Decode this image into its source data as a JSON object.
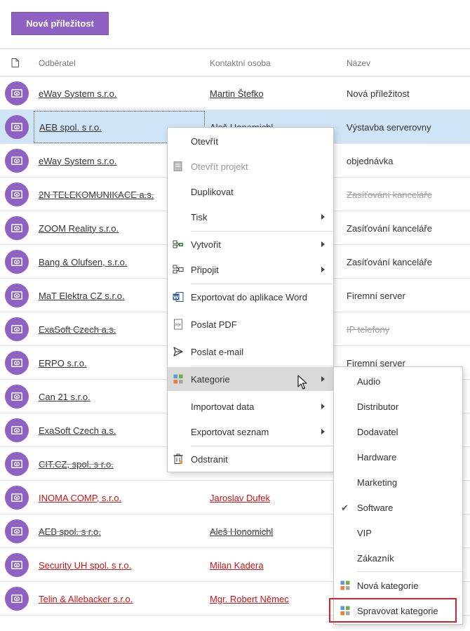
{
  "toolbar": {
    "new_button_label": "Nová příležitost"
  },
  "grid": {
    "columns": [
      "Odběratel",
      "Kontaktní osoba",
      "Název"
    ],
    "rows": [
      {
        "customer": "eWay System s.r.o.",
        "contact": "Martin Štefko",
        "name": "Nová příležitost",
        "state": "normal"
      },
      {
        "customer": "AEB spol. s r.o.",
        "contact": "Aleš Honomichl",
        "name": "Výstavba serverovny",
        "state": "selected"
      },
      {
        "customer": "eWay System s.r.o.",
        "contact": "",
        "name": "objednávka",
        "state": "normal"
      },
      {
        "customer": "2N TELEKOMUNIKACE a.s.",
        "contact": "",
        "name": "Zasíťování kanceláře",
        "state": "strike"
      },
      {
        "customer": "ZOOM Reality s.r.o.",
        "contact": "",
        "name": "Zasíťování kanceláře",
        "state": "normal"
      },
      {
        "customer": "Bang & Olufsen, s.r.o.",
        "contact": "",
        "name": "Zasíťování kanceláře",
        "state": "normal"
      },
      {
        "customer": "MaT Elektra CZ s.r.o.",
        "contact": "",
        "name": "Firemní server",
        "state": "normal"
      },
      {
        "customer": "ExaSoft Czech a.s.",
        "contact": "",
        "name": "IP telefony",
        "state": "strike"
      },
      {
        "customer": "ERPO s.r.o.",
        "contact": "",
        "name": "Firemní server",
        "state": "normal"
      },
      {
        "customer": "Can 21 s.r.o.",
        "contact": "",
        "name": "",
        "state": "normal"
      },
      {
        "customer": "ExaSoft Czech a.s.",
        "contact": "",
        "name": "",
        "state": "normal"
      },
      {
        "customer": "CIT.CZ, spol. s r.o.",
        "contact": "",
        "name": "",
        "state": "strike"
      },
      {
        "customer": "INOMA COMP, s.r.o.",
        "contact": "Jaroslav Dufek",
        "name": "",
        "state": "red"
      },
      {
        "customer": "AEB spol. s r.o.",
        "contact": "Aleš Honomichl",
        "name": "",
        "state": "strike"
      },
      {
        "customer": "Security UH spol. s r.o.",
        "contact": "Milan Kadera",
        "name": "",
        "state": "red"
      },
      {
        "customer": "Telin & Allebacker s.r.o.",
        "contact": "Mgr. Robert Němec",
        "name": "",
        "state": "red"
      }
    ]
  },
  "context_menu": {
    "items": [
      {
        "label": "Otevřít",
        "icon": "",
        "submenu": false,
        "disabled": false
      },
      {
        "label": "Otevřít projekt",
        "icon": "project-icon",
        "submenu": false,
        "disabled": true
      },
      {
        "label": "Duplikovat",
        "icon": "",
        "submenu": false,
        "disabled": false
      },
      {
        "label": "Tisk",
        "icon": "",
        "submenu": true,
        "disabled": false
      },
      {
        "label": "Vytvořit",
        "icon": "create-icon",
        "submenu": true,
        "disabled": false
      },
      {
        "label": "Připojit",
        "icon": "attach-icon",
        "submenu": true,
        "disabled": false
      },
      {
        "label": "Exportovat do aplikace Word",
        "icon": "word-icon",
        "submenu": false,
        "disabled": false
      },
      {
        "label": "Poslat PDF",
        "icon": "pdf-icon",
        "submenu": false,
        "disabled": false
      },
      {
        "label": "Poslat e-mail",
        "icon": "send-icon",
        "submenu": false,
        "disabled": false
      },
      {
        "label": "Kategorie",
        "icon": "category-icon",
        "submenu": true,
        "disabled": false,
        "hover": true
      },
      {
        "label": "Importovat data",
        "icon": "",
        "submenu": true,
        "disabled": false
      },
      {
        "label": "Exportovat seznam",
        "icon": "",
        "submenu": true,
        "disabled": false
      },
      {
        "label": "Odstranit",
        "icon": "delete-icon",
        "submenu": false,
        "disabled": false
      }
    ]
  },
  "category_submenu": {
    "items": [
      {
        "label": "Audio",
        "checked": false
      },
      {
        "label": "Distributor",
        "checked": false
      },
      {
        "label": "Dodavatel",
        "checked": false
      },
      {
        "label": "Hardware",
        "checked": false
      },
      {
        "label": "Marketing",
        "checked": false
      },
      {
        "label": "Software",
        "checked": true
      },
      {
        "label": "VIP",
        "checked": false
      },
      {
        "label": "Zákazník",
        "checked": false
      }
    ],
    "new_category": "Nová kategorie",
    "manage_categories": "Spravovat kategorie",
    "check_mark": "✔"
  },
  "colors": {
    "accent": "#8e61c2",
    "selected_row": "#cfe5f7",
    "overdue_text": "#d01414",
    "highlight_box": "#d8212c"
  }
}
